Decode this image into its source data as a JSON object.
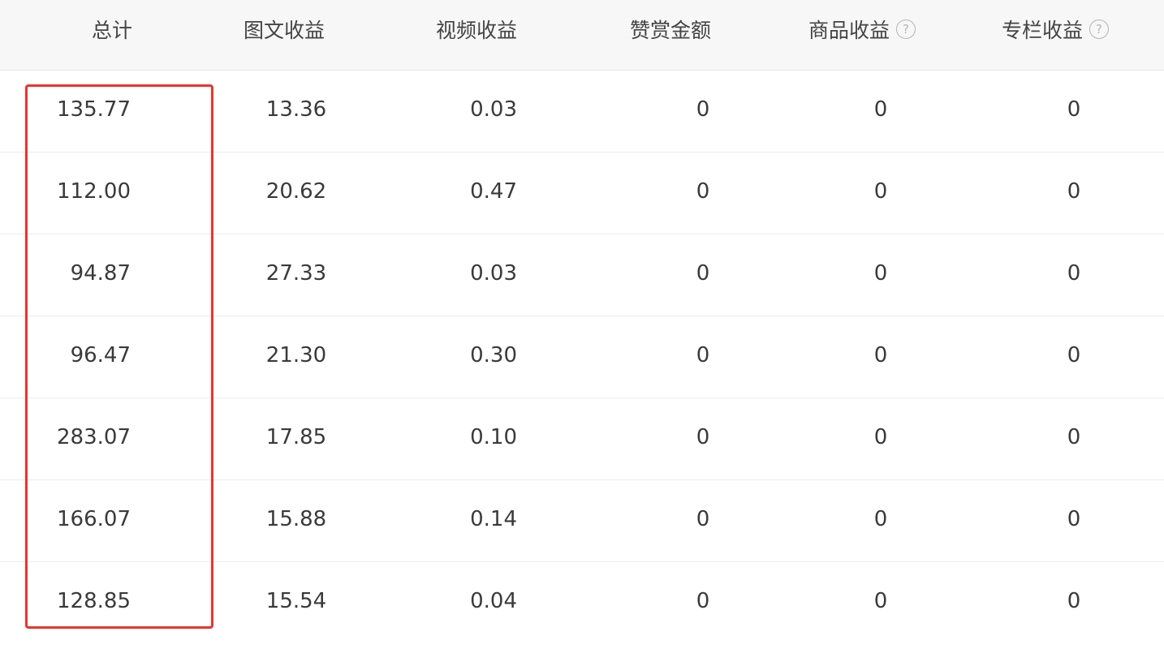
{
  "table": {
    "headers": {
      "total": "总计",
      "image_text_income": "图文收益",
      "video_income": "视频收益",
      "tip_amount": "赞赏金额",
      "goods_income": "商品收益",
      "column_income": "专栏收益",
      "help_glyph": "?"
    },
    "rows": [
      {
        "total": "135.77",
        "image_text_income": "13.36",
        "video_income": "0.03",
        "tip_amount": "0",
        "goods_income": "0",
        "column_income": "0"
      },
      {
        "total": "112.00",
        "image_text_income": "20.62",
        "video_income": "0.47",
        "tip_amount": "0",
        "goods_income": "0",
        "column_income": "0"
      },
      {
        "total": "94.87",
        "image_text_income": "27.33",
        "video_income": "0.03",
        "tip_amount": "0",
        "goods_income": "0",
        "column_income": "0"
      },
      {
        "total": "96.47",
        "image_text_income": "21.30",
        "video_income": "0.30",
        "tip_amount": "0",
        "goods_income": "0",
        "column_income": "0"
      },
      {
        "total": "283.07",
        "image_text_income": "17.85",
        "video_income": "0.10",
        "tip_amount": "0",
        "goods_income": "0",
        "column_income": "0"
      },
      {
        "total": "166.07",
        "image_text_income": "15.88",
        "video_income": "0.14",
        "tip_amount": "0",
        "goods_income": "0",
        "column_income": "0"
      },
      {
        "total": "128.85",
        "image_text_income": "15.54",
        "video_income": "0.04",
        "tip_amount": "0",
        "goods_income": "0",
        "column_income": "0"
      }
    ]
  },
  "colors": {
    "highlight_border": "#e8352f",
    "header_background": "#f7f7f7"
  },
  "icons": {
    "help": "question-circle-icon"
  }
}
